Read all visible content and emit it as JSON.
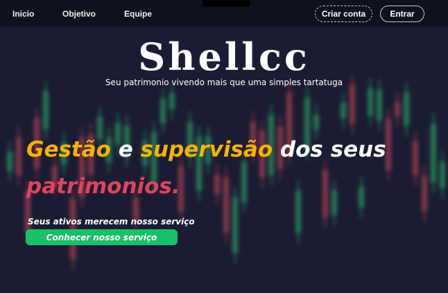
{
  "nav": {
    "links": [
      "Inicio",
      "Objetivo",
      "Equipe"
    ],
    "signup_label": "Criar conta",
    "login_label": "Entrar"
  },
  "hero": {
    "logo": "Shellcc",
    "tagline": "Seu patrimonio vivendo mais que uma simples tartatuga",
    "headline": {
      "part1": "Gestão",
      "part2": " e ",
      "part3": "supervisão",
      "part4": " dos seus",
      "part5": "patrimonios."
    },
    "subtext": "Seus ativos merecem nosso serviço",
    "cta_label": "Conhecer nosso serviço"
  },
  "colors": {
    "background": "#1b1c33",
    "navbar": "#10111f",
    "accent_yellow": "#f4b400",
    "accent_pink": "#e0435e",
    "cta_green": "#19c06a"
  }
}
